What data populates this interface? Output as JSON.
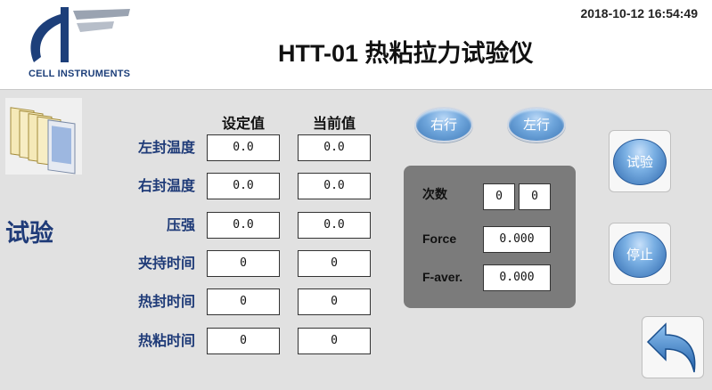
{
  "header": {
    "logo_text": "CELL INSTRUMENTS",
    "datetime": "2018-10-12 16:54:49",
    "title": "HTT-01 热粘拉力试验仪"
  },
  "mode": {
    "label": "试验",
    "icon": "document-stack-icon"
  },
  "table": {
    "col_set": "设定值",
    "col_current": "当前值",
    "rows": [
      {
        "label": "左封温度",
        "set": "0.0",
        "current": "0.0"
      },
      {
        "label": "右封温度",
        "set": "0.0",
        "current": "0.0"
      },
      {
        "label": "压强",
        "set": "0.0",
        "current": "0.0"
      },
      {
        "label": "夹持时间",
        "set": "0",
        "current": "0"
      },
      {
        "label": "热封时间",
        "set": "0",
        "current": "0"
      },
      {
        "label": "热粘时间",
        "set": "0",
        "current": "0"
      }
    ]
  },
  "buttons": {
    "right_move": "右行",
    "left_move": "左行",
    "test": "试验",
    "stop": "停止",
    "back_icon": "back-arrow-icon"
  },
  "stats": {
    "count_label": "次数",
    "count_a": "0",
    "count_b": "0",
    "force_label": "Force",
    "force_value": "0.000",
    "faver_label": "F-aver.",
    "faver_value": "0.000"
  },
  "colors": {
    "panel_bg": "#e1e1e1",
    "label_blue": "#1f3b78",
    "button_blue": "#3f78b6",
    "stats_bg": "#7b7b7b"
  }
}
